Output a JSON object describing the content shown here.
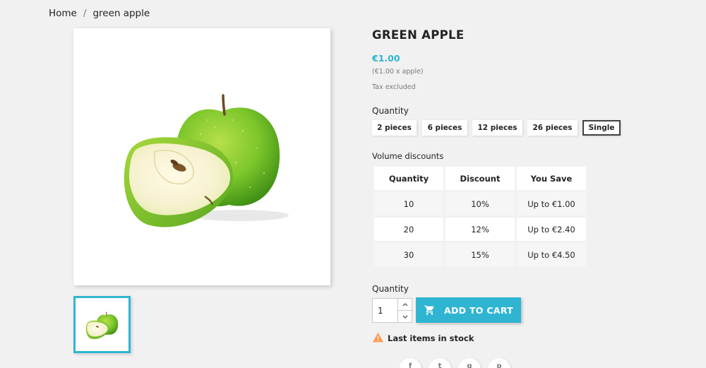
{
  "breadcrumb": {
    "home": "Home",
    "separator": "/",
    "current": "green apple"
  },
  "product": {
    "title": "GREEN APPLE",
    "price": "€1.00",
    "unit_price": "(€1.00 x apple)",
    "tax_note": "Tax excluded"
  },
  "variants": {
    "label": "Quantity",
    "options": [
      "2 pieces",
      "6 pieces",
      "12 pieces",
      "26 pieces",
      "Single"
    ],
    "selected": "Single"
  },
  "volume_discounts": {
    "label": "Volume discounts",
    "headers": [
      "Quantity",
      "Discount",
      "You Save"
    ],
    "rows": [
      [
        "10",
        "10%",
        "Up to €1.00"
      ],
      [
        "20",
        "12%",
        "Up to €2.40"
      ],
      [
        "30",
        "15%",
        "Up to €4.50"
      ]
    ]
  },
  "add_to_cart": {
    "quantity_label": "Quantity",
    "quantity_value": "1",
    "button_label": "ADD TO CART",
    "stock_message": "Last items in stock"
  },
  "icons": {
    "cart": "shopping-cart-icon",
    "warning": "warning-icon",
    "stepper_up": "chevron-up-icon",
    "stepper_down": "chevron-down-icon",
    "share": [
      "facebook-icon",
      "twitter-icon",
      "googleplus-icon",
      "pinterest-icon"
    ]
  },
  "colors": {
    "accent": "#2fb5d2",
    "warning": "#ff9a52",
    "text": "#232323",
    "muted": "#7a7a7a"
  }
}
